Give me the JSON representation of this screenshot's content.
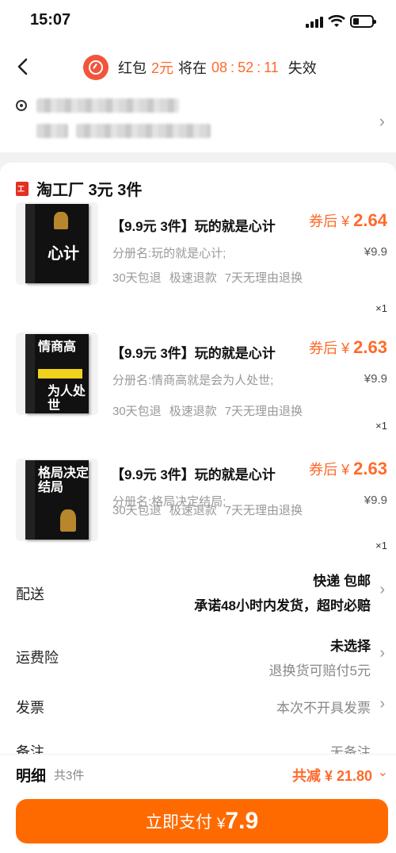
{
  "status": {
    "time": "15:07"
  },
  "nav": {
    "rp_label": "红包",
    "rp_amount": "2元",
    "rp_mid": "将在",
    "rp_h": "08",
    "rp_m": "52",
    "rp_s": "11",
    "rp_tail": "失效"
  },
  "shop": {
    "name": "淘工厂 3元 3件"
  },
  "items": [
    {
      "title": "【9.9元 3件】玩的就是心计",
      "price_prefix": "券后 ¥ ",
      "price": "2.64",
      "variant": "分册名:玩的就是心计;",
      "original_price": "¥9.9",
      "services": [
        "30天包退",
        "极速退款",
        "7天无理由退换"
      ],
      "qty": "×1",
      "cover_text": "心计"
    },
    {
      "title": "【9.9元 3件】玩的就是心计",
      "price_prefix": "券后 ¥ ",
      "price": "2.63",
      "variant": "分册名:情商高就是会为人处世;",
      "original_price": "¥9.9",
      "services": [
        "30天包退",
        "极速退款",
        "7天无理由退换"
      ],
      "qty": "×1",
      "cover_text": "情商高"
    },
    {
      "title": "【9.9元 3件】玩的就是心计",
      "price_prefix": "券后 ¥ ",
      "price": "2.63",
      "variant": "分册名:格局决定结局;",
      "original_price": "¥9.9",
      "services": [
        "30天包退",
        "极速退款",
        "7天无理由退换"
      ],
      "qty": "×1",
      "cover_text": "格局决定结局"
    }
  ],
  "delivery": {
    "label": "配送",
    "method": "快递 包邮",
    "promise": "承诺48小时内发货，超时必赔"
  },
  "insurance": {
    "label": "运费险",
    "value": "未选择",
    "hint": "退换货可赔付5元"
  },
  "invoice": {
    "label": "发票",
    "value": "本次不开具发票"
  },
  "remark": {
    "label": "备注",
    "value": "无备注"
  },
  "summary": {
    "label": "明细",
    "count": "共3件",
    "discount": "共减 ¥ 21.80"
  },
  "pay": {
    "label": "立即支付",
    "currency": "¥",
    "amount": "7.9"
  }
}
